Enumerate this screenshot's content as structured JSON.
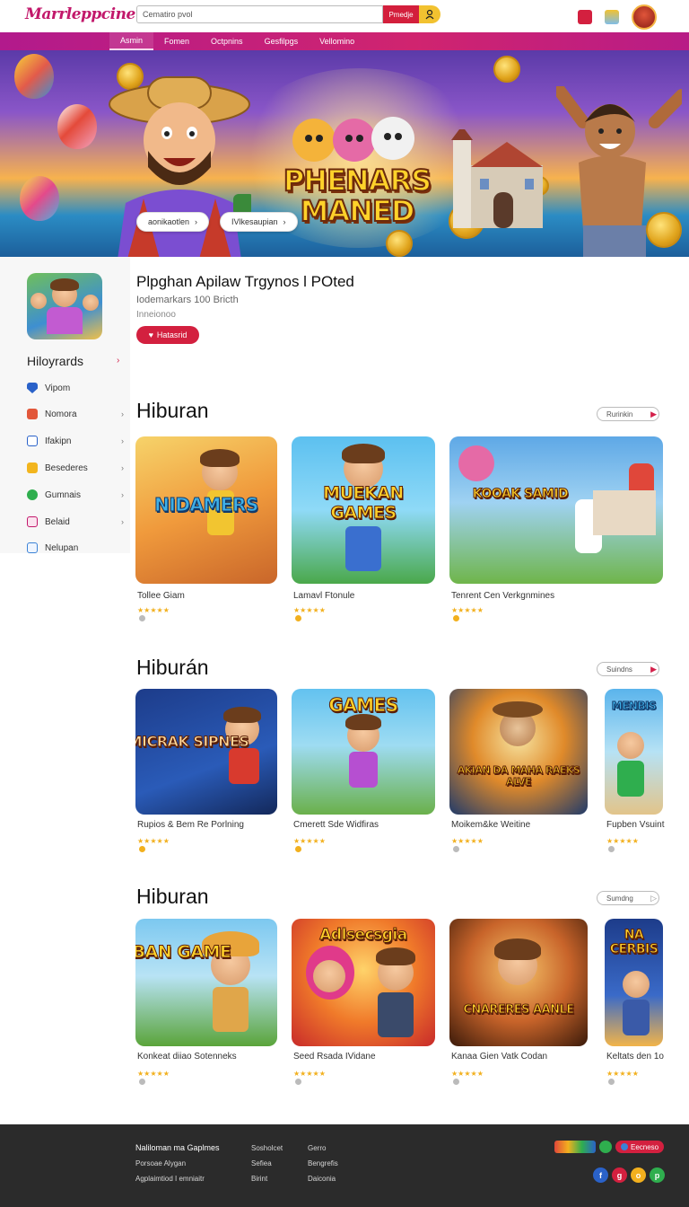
{
  "header": {
    "logo": "Marrleppcine",
    "search_value": "Cematiro pvol",
    "search_button": "Pmedje"
  },
  "nav": {
    "items": [
      "Asmin",
      "Fomen",
      "Octpnins",
      "Gesfilpgs",
      "Vellomino"
    ]
  },
  "hero": {
    "title_line1": "PHENARS",
    "title_line2": "MANED",
    "buttons": [
      "aonikaotlen",
      "IVlkesaupian"
    ]
  },
  "profile": {
    "title": "Plpghan Apilaw Trgynos l  POted",
    "subtitle": "Iodemarkars 100 Bricth",
    "meta": "Inneionoo",
    "button": "Hatasrid"
  },
  "sidebar": {
    "heading": "Hiloyrards",
    "items": [
      {
        "label": "Vipom",
        "icon": "shield-icon",
        "color": "#2a62c9"
      },
      {
        "label": "Nomora",
        "icon": "gamepad-icon",
        "color": "#e2573a"
      },
      {
        "label": "Ifakipn",
        "icon": "info-icon",
        "color": "#2a62c9"
      },
      {
        "label": "Besederes",
        "icon": "box-icon",
        "color": "#f2b51e"
      },
      {
        "label": "Gumnais",
        "icon": "chat-icon",
        "color": "#2fae4e"
      },
      {
        "label": "Belaid",
        "icon": "bag-icon",
        "color": "#c2186b"
      },
      {
        "label": "Nelupan",
        "icon": "document-icon",
        "color": "#3b82d6"
      }
    ]
  },
  "sections": [
    {
      "title": "Hiburan",
      "more": "Rurinkin",
      "cards": [
        {
          "name": "Tollee Giam",
          "thumb_title": "NIDAMERS"
        },
        {
          "name": "Lamavl Ftonule",
          "thumb_title": "MUEKAN GAMES"
        },
        {
          "name": "Tenrent Cen Verkgnmines",
          "thumb_title": "KOOAK SAMID"
        }
      ]
    },
    {
      "title": "Hiburán",
      "more": "Suindns",
      "cards": [
        {
          "name": "Rupios & Bem Re Porlning",
          "thumb_title": "MICRAK SIPNES"
        },
        {
          "name": "Cmerett Sde Widfiras",
          "thumb_title": "GAMES"
        },
        {
          "name": "Moikem&ke Weitine",
          "thumb_title": "AKIAN DA MAHA RAEKS ALVE"
        },
        {
          "name": "Fupben Vsuint",
          "thumb_title": "MENBIS"
        }
      ]
    },
    {
      "title": "Hiburan",
      "more": "Sumdng",
      "cards": [
        {
          "name": "Konkeat diiao Sotenneks",
          "thumb_title": "MIBAN GAME"
        },
        {
          "name": "Seed Rsada IVidane",
          "thumb_title": "Adlsecsgia"
        },
        {
          "name": "Kanaa Gien Vatk Codan",
          "thumb_title": "CNARERES AANLE"
        },
        {
          "name": "Keltats den 1o",
          "thumb_title": "NA CERBIS"
        }
      ]
    }
  ],
  "footer": {
    "col1_head": "Naliloman ma Gaplmes",
    "col1": [
      "Porsoae Alygan",
      "Agplaimtiod I emniaitr"
    ],
    "col2": [
      "Sosholcet",
      "Sefiea",
      "Birint"
    ],
    "col3": [
      "Gerro",
      "Bengrefis",
      "Daiconia"
    ],
    "badge": "Eecneso",
    "social": [
      "f",
      "g",
      "o",
      "p"
    ]
  },
  "colors": {
    "brand": "#c2186b",
    "accent_red": "#d3203f",
    "star": "#f2b01e"
  }
}
